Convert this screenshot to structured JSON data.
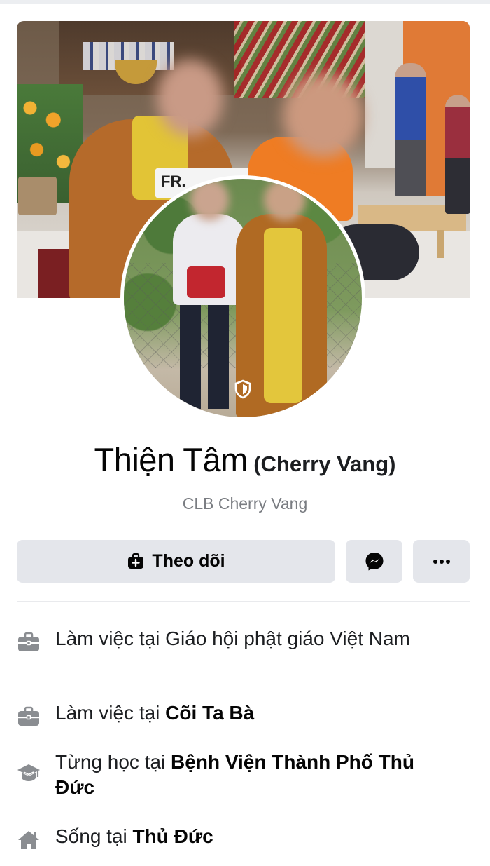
{
  "profile": {
    "name": "Thiện Tâm",
    "alternate_name": "(Cherry Vang)",
    "subtitle": "CLB Cherry Vang",
    "cover_sign_text": "FR."
  },
  "actions": {
    "follow_label": "Theo dõi",
    "follow_icon": "add-follow-icon",
    "message_icon": "messenger-icon",
    "more_icon": "more-icon"
  },
  "intro": [
    {
      "icon": "briefcase-icon",
      "prefix": "Làm việc tại Giáo hội phật giáo Việt Nam",
      "bold": ""
    },
    {
      "icon": "briefcase-icon",
      "prefix": "Làm việc tại ",
      "bold": "Cõi Ta Bà"
    },
    {
      "icon": "graduation-cap-icon",
      "prefix": "Từng học tại ",
      "bold": "Bệnh Viện Thành Phố Thủ Đức"
    },
    {
      "icon": "home-icon",
      "prefix": "Sống tại ",
      "bold": "Thủ Đức"
    }
  ],
  "colors": {
    "button_bg": "#e4e6eb",
    "icon_gray": "#8a8d91",
    "subtitle_gray": "#7a7d82"
  }
}
